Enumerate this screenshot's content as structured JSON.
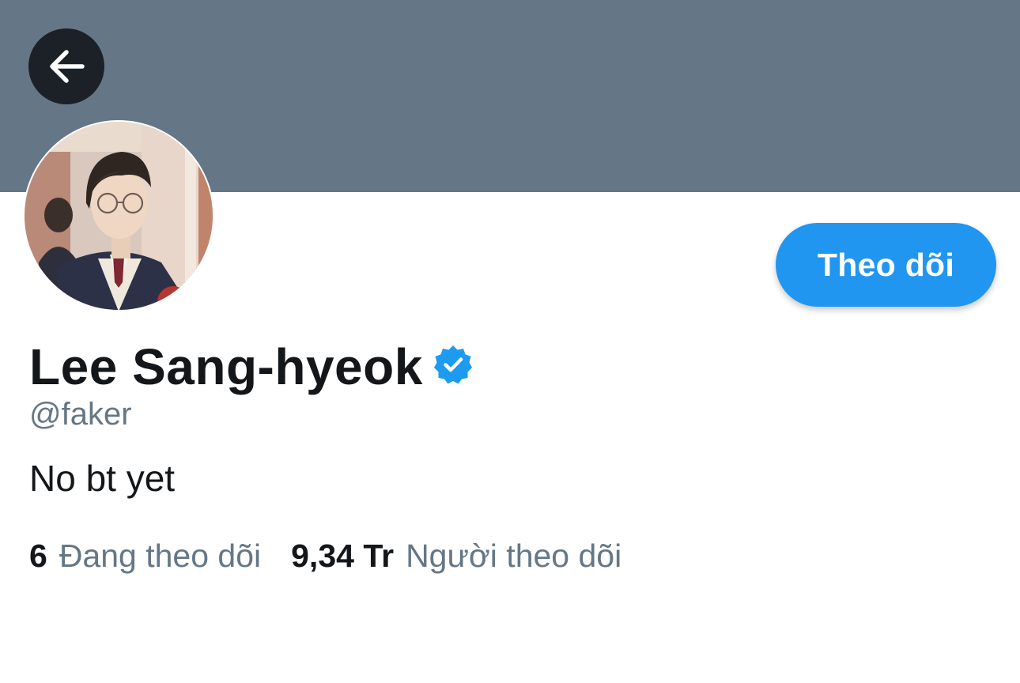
{
  "header": {
    "back_icon": "arrow-left-icon",
    "banner_color": "#657786"
  },
  "profile": {
    "avatar": "profile-photo",
    "display_name": "Lee Sang-hyeok",
    "verified": true,
    "verified_icon": "verified-badge-icon",
    "handle": "@faker",
    "bio": "No bt yet"
  },
  "actions": {
    "follow_label": "Theo dõi",
    "follow_color": "#2196f0"
  },
  "stats": {
    "following_count": "6",
    "following_label": "Đang theo dõi",
    "followers_count": "9,34 Tr",
    "followers_label": "Người theo dõi"
  }
}
